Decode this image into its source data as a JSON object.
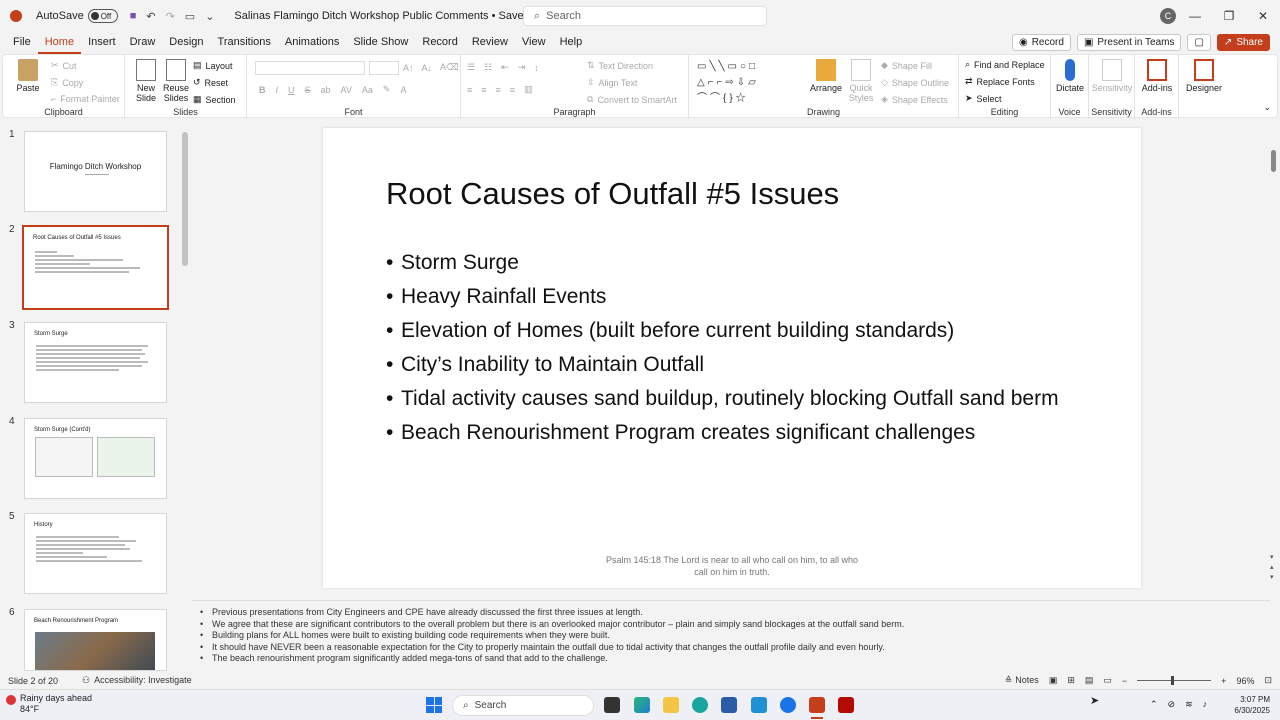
{
  "titlebar": {
    "autosave_label": "AutoSave",
    "autosave_state": "Off",
    "document_title": "Salinas Flamingo Ditch Workshop Public Comments • Saved to this PC",
    "search_placeholder": "Search",
    "profile_initial": "C"
  },
  "tabs": [
    "File",
    "Home",
    "Insert",
    "Draw",
    "Design",
    "Transitions",
    "Animations",
    "Slide Show",
    "Record",
    "Review",
    "View",
    "Help"
  ],
  "tab_actions": {
    "record": "Record",
    "present_teams": "Present in Teams",
    "share": "Share"
  },
  "ribbon": {
    "clipboard": {
      "paste": "Paste",
      "cut": "Cut",
      "copy": "Copy",
      "format_painter": "Format Painter",
      "label": "Clipboard"
    },
    "slides": {
      "new_slide": "New Slide",
      "reuse_slides": "Reuse Slides",
      "layout": "Layout",
      "reset": "Reset",
      "section": "Section",
      "label": "Slides"
    },
    "font": {
      "label": "Font",
      "bold": "B",
      "italic": "I",
      "underline": "U",
      "strike": "S"
    },
    "paragraph": {
      "text_direction": "Text Direction",
      "align_text": "Align Text",
      "smartart": "Convert to SmartArt",
      "label": "Paragraph"
    },
    "drawing": {
      "arrange": "Arrange",
      "quick_styles": "Quick Styles",
      "shape_fill": "Shape Fill",
      "shape_outline": "Shape Outline",
      "shape_effects": "Shape Effects",
      "label": "Drawing"
    },
    "editing": {
      "find_replace": "Find and Replace",
      "replace_fonts": "Replace Fonts",
      "select": "Select",
      "label": "Editing"
    },
    "voice": {
      "dictate": "Dictate",
      "label": "Voice"
    },
    "sensitivity": {
      "button": "Sensitivity",
      "label": "Sensitivity"
    },
    "addins": {
      "button": "Add-ins",
      "label": "Add-ins"
    },
    "designer": {
      "button": "Designer"
    }
  },
  "thumbnails": [
    {
      "num": "1",
      "title": "Flamingo Ditch Workshop"
    },
    {
      "num": "2",
      "title": "Root Causes of Outfall #5 Issues"
    },
    {
      "num": "3",
      "title": "Storm Surge"
    },
    {
      "num": "4",
      "title": "Storm Surge (Cont'd)"
    },
    {
      "num": "5",
      "title": "History"
    },
    {
      "num": "6",
      "title": "Beach Renourishment Program"
    }
  ],
  "slide": {
    "title": "Root Causes of Outfall #5 Issues",
    "bullets": [
      "Storm Surge",
      "Heavy Rainfall Events",
      "Elevation of Homes (built before current building standards)",
      "City’s Inability to Maintain Outfall",
      "Tidal activity causes sand buildup, routinely blocking Outfall sand berm",
      "Beach Renourishment Program creates significant challenges"
    ],
    "footer": "Psalm 145:18 The Lord is near to all who call on him, to all who call on him in truth."
  },
  "notes": [
    "Previous presentations from City Engineers and CPE have already discussed the first three issues at length.",
    "We agree that these are significant contributors to the overall problem but there is an overlooked major contributor – plain and simply sand blockages at the outfall sand berm.",
    "Building plans for ALL homes were built to existing building code requirements when they were built.",
    "It should have NEVER been a reasonable expectation for the City to properly maintain the outfall due to tidal activity that changes the outfall profile daily and even hourly.",
    "The beach renourishment program significantly added mega-tons of sand that add to the challenge."
  ],
  "statusbar": {
    "slide_info": "Slide 2 of 20",
    "accessibility": "Accessibility: Investigate",
    "notes": "Notes",
    "zoom": "96%"
  },
  "taskbar": {
    "weather_title": "Rainy days ahead",
    "weather_temp": "84°F",
    "search": "Search",
    "time": "3:07 PM",
    "date": "6/30/2025"
  },
  "colors": {
    "accent": "#c43e1c"
  }
}
